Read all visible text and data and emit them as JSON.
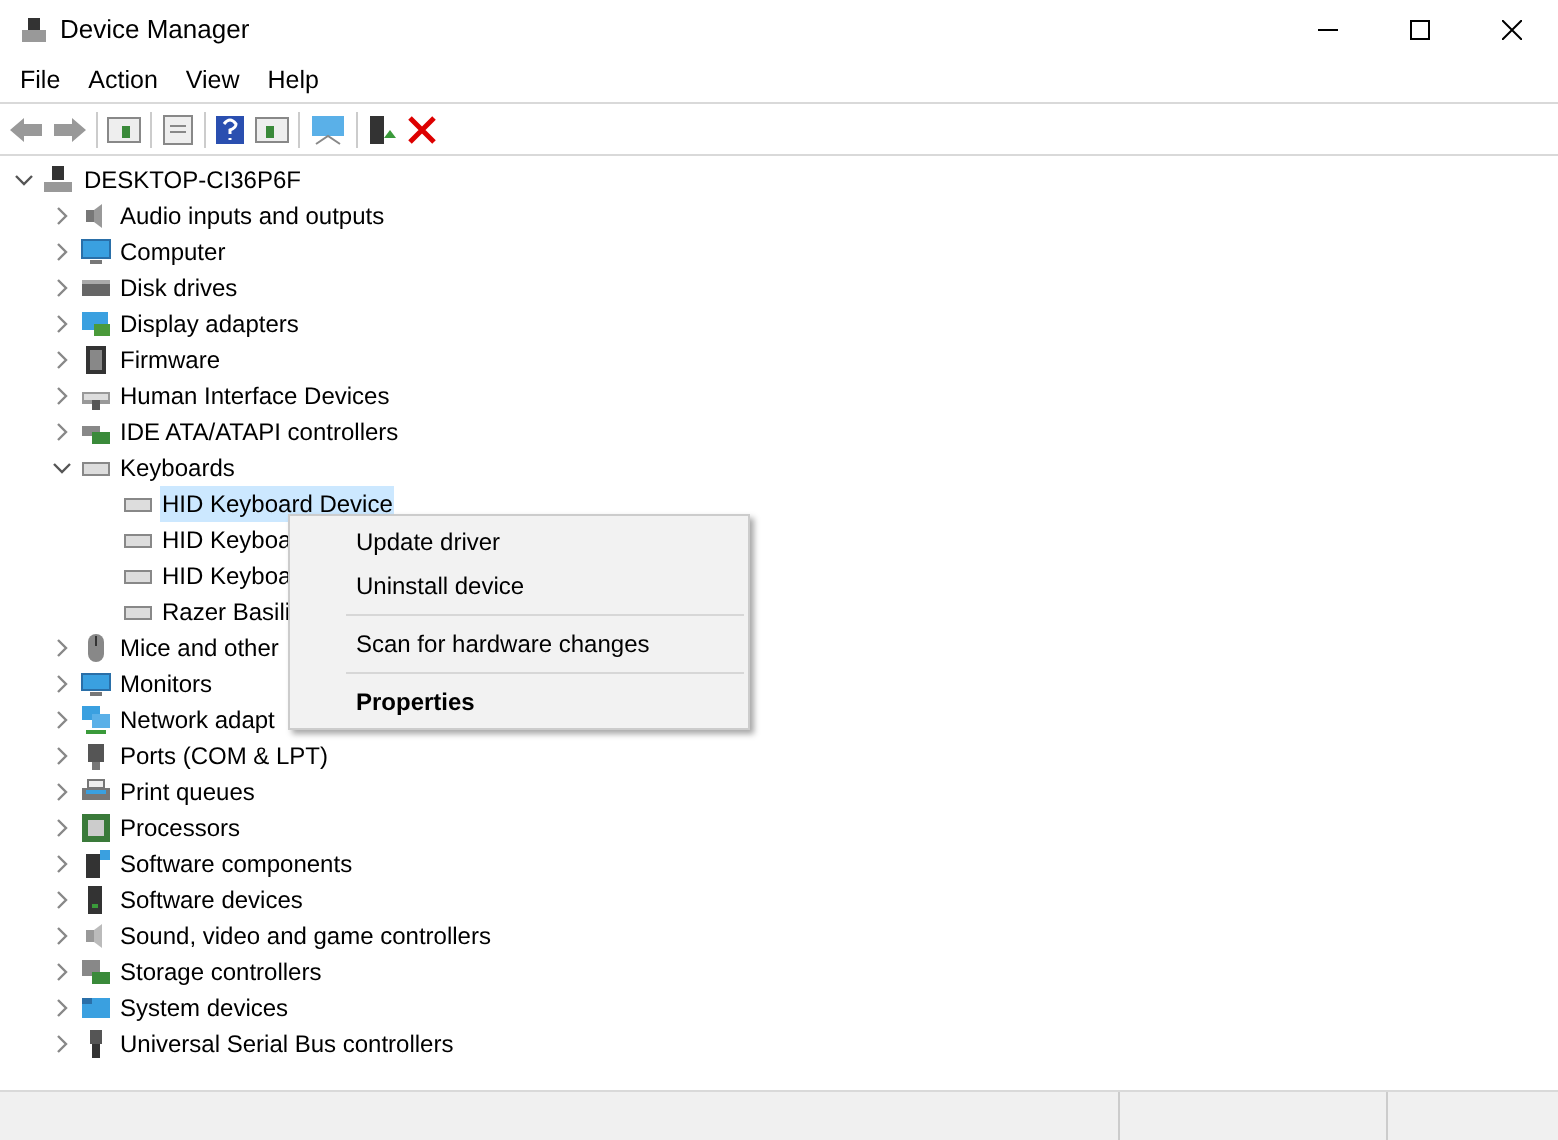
{
  "window": {
    "title": "Device Manager"
  },
  "menu_bar": [
    "File",
    "Action",
    "View",
    "Help"
  ],
  "tree": {
    "label": "DESKTOP-CI36P6F",
    "expanded": true,
    "children": [
      {
        "label": "Audio inputs and outputs",
        "expanded": false
      },
      {
        "label": "Computer",
        "expanded": false
      },
      {
        "label": "Disk drives",
        "expanded": false
      },
      {
        "label": "Display adapters",
        "expanded": false
      },
      {
        "label": "Firmware",
        "expanded": false
      },
      {
        "label": "Human Interface Devices",
        "expanded": false
      },
      {
        "label": "IDE ATA/ATAPI controllers",
        "expanded": false
      },
      {
        "label": "Keyboards",
        "expanded": true,
        "children": [
          {
            "label": "HID Keyboard Device",
            "selected": true
          },
          {
            "label": "HID Keyboa",
            "selected": false
          },
          {
            "label": "HID Keyboa",
            "selected": false
          },
          {
            "label": "Razer Basili",
            "selected": false
          }
        ]
      },
      {
        "label": "Mice and other",
        "expanded": false
      },
      {
        "label": "Monitors",
        "expanded": false
      },
      {
        "label": "Network adapt",
        "expanded": false
      },
      {
        "label": "Ports (COM & LPT)",
        "expanded": false
      },
      {
        "label": "Print queues",
        "expanded": false
      },
      {
        "label": "Processors",
        "expanded": false
      },
      {
        "label": "Software components",
        "expanded": false
      },
      {
        "label": "Software devices",
        "expanded": false
      },
      {
        "label": "Sound, video and game controllers",
        "expanded": false
      },
      {
        "label": "Storage controllers",
        "expanded": false
      },
      {
        "label": "System devices",
        "expanded": false
      },
      {
        "label": "Universal Serial Bus controllers",
        "expanded": false
      }
    ]
  },
  "context_menu": [
    {
      "kind": "item",
      "label": "Update driver"
    },
    {
      "kind": "item",
      "label": "Uninstall device"
    },
    {
      "kind": "separator"
    },
    {
      "kind": "item",
      "label": "Scan for hardware changes"
    },
    {
      "kind": "separator"
    },
    {
      "kind": "default",
      "label": "Properties"
    }
  ]
}
